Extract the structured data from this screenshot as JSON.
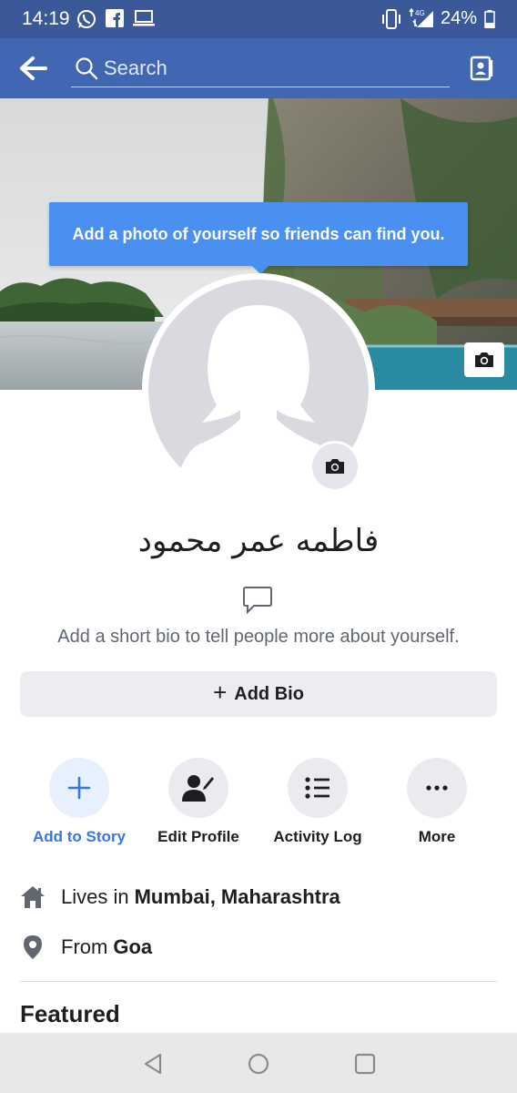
{
  "status_bar": {
    "time": "14:19",
    "battery_percent": "24%",
    "icons": [
      "whatsapp-icon",
      "facebook-icon",
      "laptop-icon",
      "vibrate-icon",
      "4g-signal-icon",
      "battery-icon"
    ]
  },
  "nav": {
    "search_placeholder": "Search",
    "back_icon": "arrow-left-icon",
    "contacts_icon": "contacts-icon"
  },
  "cover": {
    "camera_icon": "camera-icon"
  },
  "tooltip": {
    "text": "Add a photo of yourself so friends can find you."
  },
  "profile": {
    "name": "فاطمه عمر محمود",
    "bio_hint": "Add a short bio to tell people more about yourself.",
    "add_bio_label": "Add Bio",
    "add_bio_plus": "+"
  },
  "actions": [
    {
      "label": "Add to Story",
      "icon": "plus-icon"
    },
    {
      "label": "Edit Profile",
      "icon": "edit-person-icon"
    },
    {
      "label": "Activity Log",
      "icon": "list-icon"
    },
    {
      "label": "More",
      "icon": "ellipsis-icon"
    }
  ],
  "info": {
    "lives_prefix": "Lives in",
    "lives_value": "Mumbai, Maharashtra",
    "from_prefix": "From",
    "from_value": "Goa"
  },
  "featured_heading": "Featured",
  "colors": {
    "header_blue": "#4267b2",
    "status_blue": "#3b5998",
    "tooltip_blue": "#4a90f0",
    "accent_blue": "#3578e5"
  }
}
